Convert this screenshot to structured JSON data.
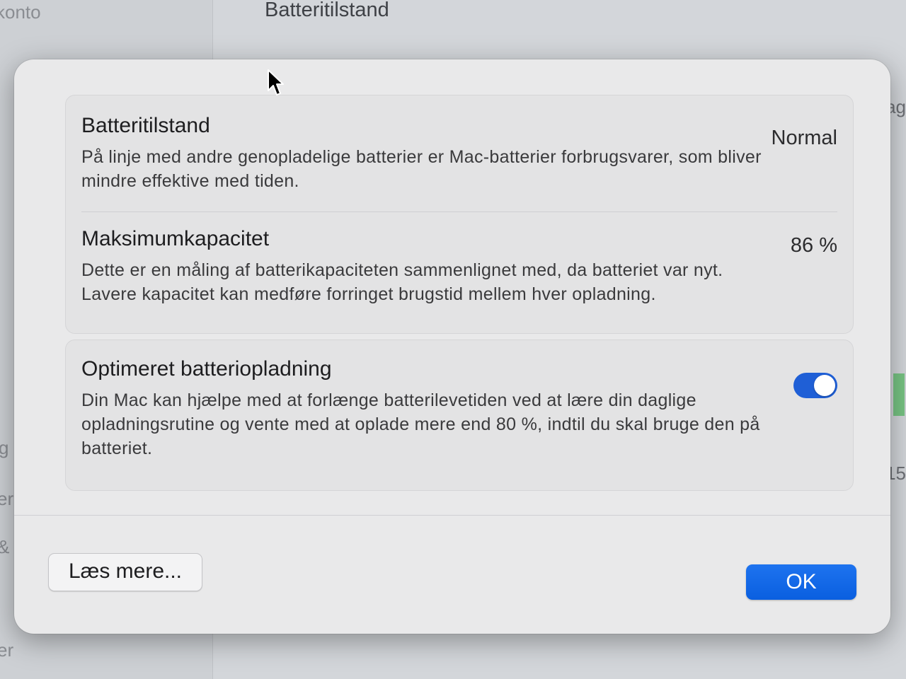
{
  "background": {
    "window_title": "Batteritilstand",
    "sidebar_fragments": [
      "konto",
      "g",
      "er",
      "&",
      "er"
    ],
    "right_fragments": [
      "ag",
      "15"
    ]
  },
  "sheet": {
    "battery_health": {
      "title": "Batteritilstand",
      "description": "På linje med andre genopladelige batterier er Mac-batterier forbrugsvarer, som bliver mindre effektive med tiden.",
      "value": "Normal"
    },
    "max_capacity": {
      "title": "Maksimumkapacitet",
      "description": "Dette er en måling af batterikapaciteten sammenlignet med, da batteriet var nyt. Lavere kapacitet kan medføre forringet brugstid mellem hver opladning.",
      "value": "86 %"
    },
    "optimized_charging": {
      "title": "Optimeret batteriopladning",
      "description": "Din Mac kan hjælpe med at forlænge batterilevetiden ved at lære din daglige opladningsrutine og vente med at oplade mere end 80 %, indtil du skal bruge den på batteriet.",
      "enabled": true
    },
    "learn_more_label": "Læs mere...",
    "ok_label": "OK"
  },
  "colors": {
    "accent": "#0a5fe0",
    "toggle_on": "#1f5fd6",
    "sheet_background": "#e9e9ea"
  }
}
